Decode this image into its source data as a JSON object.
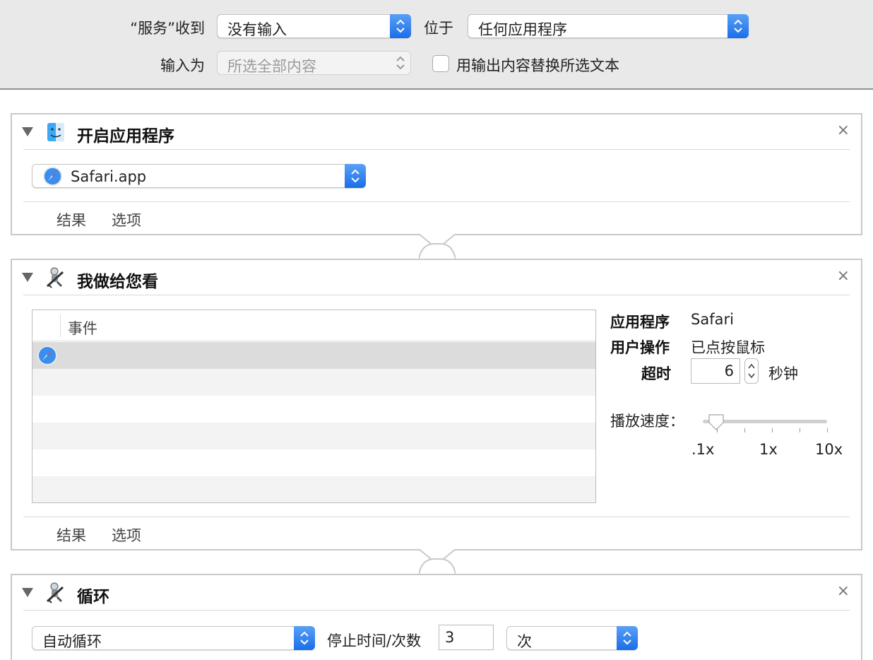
{
  "top": {
    "receives_label": "“服务”收到",
    "receives_value": "没有输入",
    "in_label": "位于",
    "in_value": "任何应用程序",
    "input_is_label": "输入为",
    "input_is_value": "所选全部内容",
    "replace_label": "用输出内容替换所选文本"
  },
  "panel1": {
    "title": "开启应用程序",
    "app_value": "Safari.app",
    "tab_results": "结果",
    "tab_options": "选项",
    "close": "×"
  },
  "panel2": {
    "title": "我做给您看",
    "column_events": "事件",
    "app_label": "应用程序",
    "app_value": "Safari",
    "user_action_label": "用户操作",
    "user_action_value": "已点按鼠标",
    "timeout_label": "超时",
    "timeout_value": "6",
    "timeout_unit": "秒钟",
    "speed_label": "播放速度：",
    "speed_level": 0.1,
    "speed_ticks": [
      ".1x",
      "1x",
      "10x"
    ],
    "tab_results": "结果",
    "tab_options": "选项",
    "close": "×"
  },
  "panel3": {
    "title": "循环",
    "mode_value": "自动循环",
    "stop_label": "停止时间/次数",
    "count_value": "3",
    "unit_value": "次",
    "close": "×"
  },
  "colors": {
    "accent": "#1a6ee8",
    "toolbar_bg": "#e9e9e9"
  },
  "icons": [
    "finder-icon",
    "automator-robot-icon",
    "safari-icon",
    "disclosure-triangle-icon",
    "close-icon",
    "popup-chevron-icon"
  ]
}
